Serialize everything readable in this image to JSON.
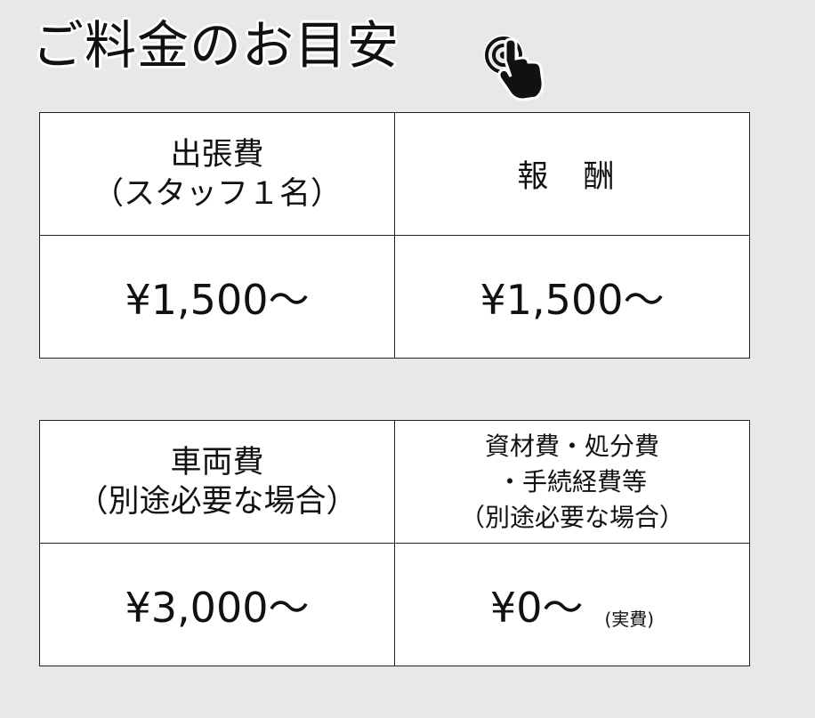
{
  "page": {
    "title": "ご料金のお目安",
    "title_icon": "tap-hand-icon"
  },
  "table1": {
    "header_left_main": "出張費",
    "header_left_sub": "（スタッフ１名）",
    "header_right": "報 酬",
    "value_left": "¥1,500～",
    "value_right": "¥1,500～"
  },
  "table2": {
    "header_left_main": "車両費",
    "header_left_sub": "（別途必要な場合）",
    "header_right_line1": "資材費・処分費",
    "header_right_line2": "・手続経費等",
    "header_right_line3": "（別途必要な場合）",
    "value_left": "¥3,000～",
    "value_right": "¥0～",
    "value_right_note": "(実費)"
  }
}
